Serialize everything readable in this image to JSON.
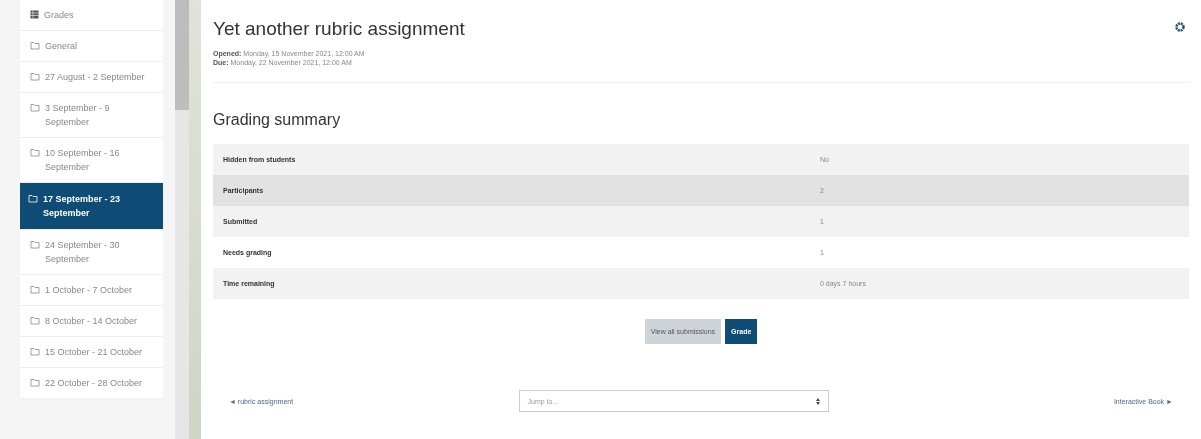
{
  "sidebar": {
    "items": [
      {
        "kind": "grades",
        "label": "Grades",
        "selected": false
      },
      {
        "kind": "section",
        "label": "General",
        "selected": false
      },
      {
        "kind": "section",
        "label": "27 August - 2 September",
        "selected": false
      },
      {
        "kind": "section",
        "label": "3 September - 9 September",
        "selected": false
      },
      {
        "kind": "section",
        "label": "10 September - 16 September",
        "selected": false
      },
      {
        "kind": "section",
        "label": "17 September - 23 September",
        "selected": true
      },
      {
        "kind": "section",
        "label": "24 September - 30 September",
        "selected": false
      },
      {
        "kind": "section",
        "label": "1 October - 7 October",
        "selected": false
      },
      {
        "kind": "section",
        "label": "8 October - 14 October",
        "selected": false
      },
      {
        "kind": "section",
        "label": "15 October - 21 October",
        "selected": false
      },
      {
        "kind": "section",
        "label": "22 October - 28 October",
        "selected": false
      }
    ]
  },
  "page": {
    "title": "Yet another rubric assignment",
    "dates": [
      {
        "label": "Opened:",
        "value": "Monday, 15 November 2021, 12:00 AM"
      },
      {
        "label": "Due:",
        "value": "Monday, 22 November 2021, 12:00 AM"
      }
    ]
  },
  "grading_summary": {
    "heading": "Grading summary",
    "rows": [
      {
        "label": "Hidden from students",
        "value": "No",
        "hovered": false
      },
      {
        "label": "Participants",
        "value": "2",
        "hovered": true
      },
      {
        "label": "Submitted",
        "value": "1",
        "hovered": false
      },
      {
        "label": "Needs grading",
        "value": "1",
        "hovered": false
      },
      {
        "label": "Time remaining",
        "value": "0 days 7 hours",
        "hovered": false
      }
    ]
  },
  "buttons": [
    {
      "kind": "secondary",
      "label": "View all submissions"
    },
    {
      "kind": "primary",
      "label": "Grade"
    }
  ],
  "footer": {
    "previous": "◄ rubric assignment",
    "jump": {
      "placeholder": "Jump to..."
    },
    "next": "Interactive Book ►"
  }
}
